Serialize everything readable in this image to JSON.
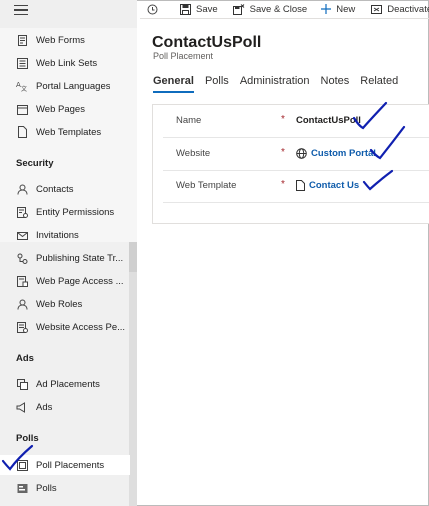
{
  "sidebar": {
    "upper_items": [
      {
        "label": "Web Forms",
        "icon": "web-forms-icon"
      },
      {
        "label": "Web Link Sets",
        "icon": "web-link-sets-icon"
      },
      {
        "label": "Portal Languages",
        "icon": "portal-languages-icon"
      },
      {
        "label": "Web Pages",
        "icon": "web-pages-icon"
      },
      {
        "label": "Web Templates",
        "icon": "web-templates-icon"
      }
    ],
    "security_header": "Security",
    "security_items": [
      {
        "label": "Contacts",
        "icon": "person-icon"
      },
      {
        "label": "Entity Permissions",
        "icon": "entity-permissions-icon"
      },
      {
        "label": "Invitations",
        "icon": "invitation-icon"
      },
      {
        "label": "Publishing State Tr...",
        "icon": "publishing-state-icon"
      },
      {
        "label": "Web Page Access ...",
        "icon": "page-access-icon"
      },
      {
        "label": "Web Roles",
        "icon": "person-icon"
      },
      {
        "label": "Website Access Pe...",
        "icon": "website-access-icon"
      }
    ],
    "ads_header": "Ads",
    "ads_items": [
      {
        "label": "Ad Placements",
        "icon": "ad-placements-icon"
      },
      {
        "label": "Ads",
        "icon": "megaphone-icon"
      }
    ],
    "polls_header": "Polls",
    "polls_items": [
      {
        "label": "Poll Placements",
        "icon": "poll-placements-icon",
        "selected": true
      },
      {
        "label": "Polls",
        "icon": "polls-icon"
      }
    ]
  },
  "commandbar": {
    "save": "Save",
    "save_close": "Save & Close",
    "new": "New",
    "deactivate": "Deactivate"
  },
  "form": {
    "title": "ContactUsPoll",
    "subtitle": "Poll Placement",
    "tabs": [
      "General",
      "Polls",
      "Administration",
      "Notes",
      "Related"
    ],
    "active_tab": "General",
    "fields": [
      {
        "label": "Name",
        "required": "*",
        "value": "ContactUsPoll",
        "type": "text"
      },
      {
        "label": "Website",
        "required": "*",
        "value": "Custom Portal",
        "type": "lookup",
        "icon": "globe-icon"
      },
      {
        "label": "Web Template",
        "required": "*",
        "value": "Contact Us",
        "type": "lookup",
        "icon": "document-icon"
      }
    ]
  },
  "colors": {
    "accent": "#0f6cbd",
    "link": "#0f5cab",
    "required": "#a4262c",
    "annotation": "#1020b0"
  }
}
